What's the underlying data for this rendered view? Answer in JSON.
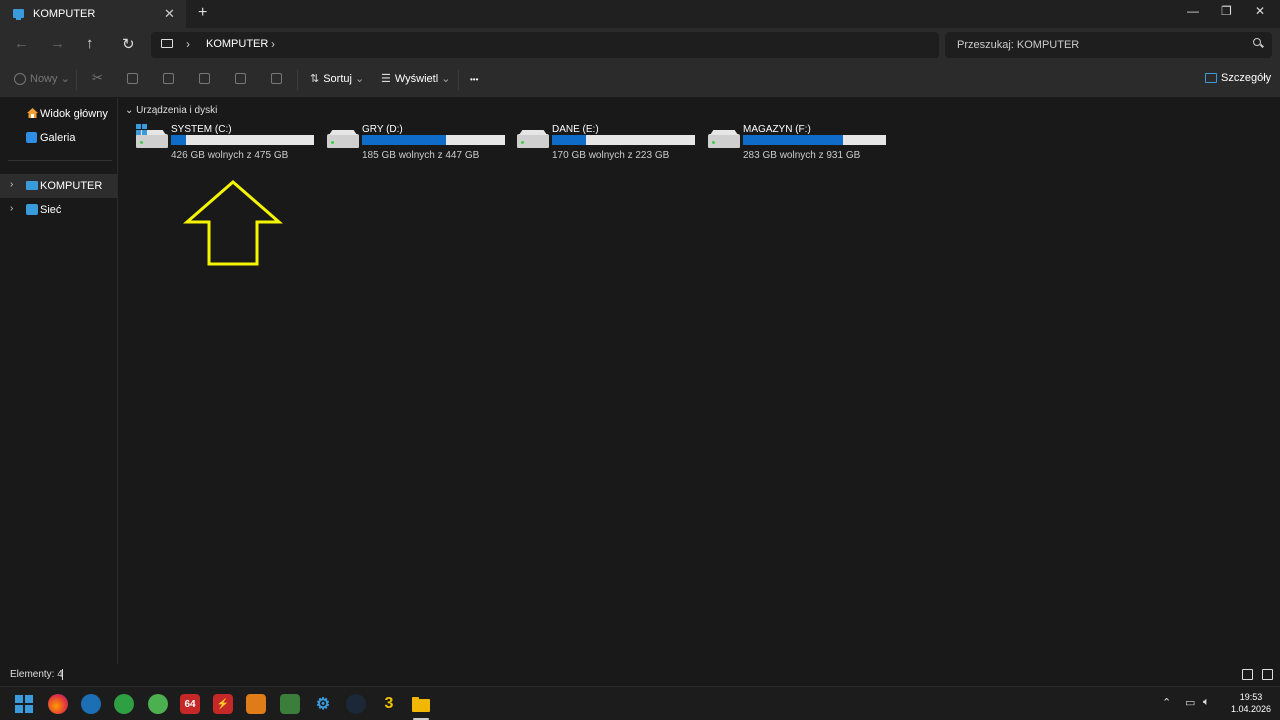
{
  "window": {
    "tab_title": "KOMPUTER",
    "new_tab": "+",
    "close_tab": "✕",
    "minimize": "—",
    "maximize": "❐",
    "close": "✕"
  },
  "address": {
    "breadcrumb": "KOMPUTER",
    "search_placeholder": "Przeszukaj: KOMPUTER"
  },
  "toolbar": {
    "new_label": "Nowy",
    "sort_label": "Sortuj",
    "view_label": "Wyświetl",
    "more_label": "•••",
    "details_label": "Szczegóły"
  },
  "sidebar": {
    "items": [
      {
        "label": "Widok główny",
        "icon": "home-icon"
      },
      {
        "label": "Galeria",
        "icon": "gallery-icon"
      },
      {
        "label": "KOMPUTER",
        "icon": "computer-icon",
        "selected": true
      },
      {
        "label": "Sieć",
        "icon": "network-icon"
      }
    ]
  },
  "content": {
    "group_header": "Urządzenia i dyski",
    "drives": [
      {
        "name": "SYSTEM (C:)",
        "free_text": "426 GB wolnych z 475 GB",
        "used_fraction": 0.103,
        "system": true
      },
      {
        "name": "GRY (D:)",
        "free_text": "185 GB wolnych z 447 GB",
        "used_fraction": 0.586
      },
      {
        "name": "DANE (E:)",
        "free_text": "170 GB wolnych z 223 GB",
        "used_fraction": 0.238
      },
      {
        "name": "MAGAZYN (F:)",
        "free_text": "283 GB wolnych z 931 GB",
        "used_fraction": 0.696
      }
    ],
    "annotation_color": "#f5f500"
  },
  "status": {
    "items_count": "Elementy: 4"
  },
  "taskbar": {
    "apps": [
      {
        "name": "start-icon"
      },
      {
        "name": "firefox-icon"
      },
      {
        "name": "app-icon"
      },
      {
        "name": "app-icon"
      },
      {
        "name": "app-icon"
      },
      {
        "name": "aida64-icon",
        "label": "64"
      },
      {
        "name": "app-icon"
      },
      {
        "name": "cpuz-icon"
      },
      {
        "name": "app-icon"
      },
      {
        "name": "settings-icon"
      },
      {
        "name": "steam-icon"
      },
      {
        "name": "app-icon",
        "label": "3"
      },
      {
        "name": "file-explorer-icon"
      }
    ],
    "time": "19:53",
    "date": "1.04.2026"
  }
}
